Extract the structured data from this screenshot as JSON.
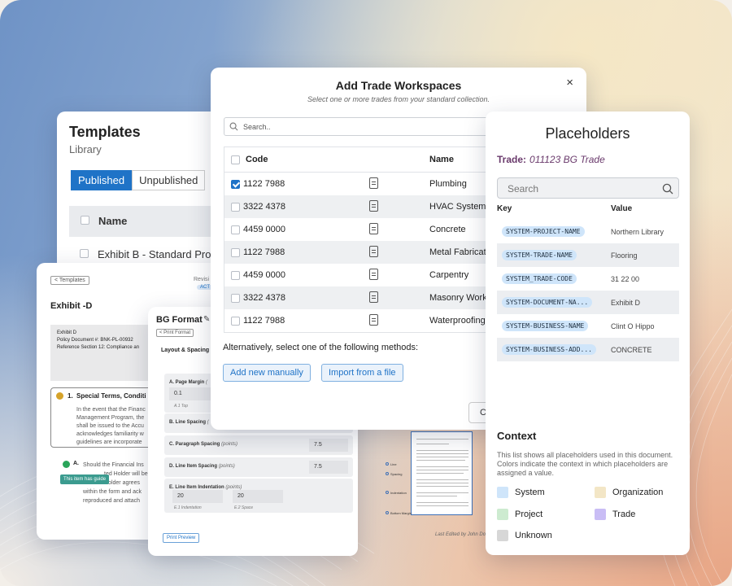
{
  "templates": {
    "title": "Templates",
    "subtitle": "Library",
    "tabs": [
      "Published",
      "Unpublished"
    ],
    "column_name": "Name",
    "rows": [
      "Exhibit B - Standard Pro"
    ]
  },
  "exhibit": {
    "back": "< Templates",
    "revision_label": "Revisi",
    "status": "ACT",
    "title": "Exhibit -D",
    "doc_lines": [
      "Exhibit D",
      "Policy Document #: BNK-PL-00932",
      "Reference Section 12: Compliance an"
    ],
    "section_num": "1.",
    "section_title": "Special Terms, Conditi",
    "section_body": [
      "In the event that the Financ",
      "Management Program, the",
      "shall be issued to the Accu",
      "acknowledges familiarity w",
      "guidelines are incorporate"
    ],
    "item_label": "A.",
    "item_body": [
      "Should the Financial Ins",
      "ted Holder will be",
      "Holder agrees",
      "within the form and ack",
      "reproduced and attach"
    ],
    "tooltip": "This item has guide"
  },
  "bgformat": {
    "title": "BG Format",
    "print_format": "< Print Format",
    "layout_heading": "Layout & Spacing",
    "page_margin_label": "A. Page Margin",
    "page_margin_unit": "(",
    "page_margin_value": "0.1",
    "page_margin_hint": "A.1 Top",
    "line_spacing_label": "B. Line Spacing",
    "line_spacing_unit": "(",
    "para_spacing_label": "C. Paragraph Spacing",
    "para_spacing_unit": "(points)",
    "para_spacing_value": "7.5",
    "line_item_spacing_label": "D. Line Item Spacing",
    "line_item_spacing_unit": "(points)",
    "line_item_spacing_value": "7.5",
    "indent_label": "E. Line Item Indentation",
    "indent_unit": "(points)",
    "indent_value_1": "20",
    "indent_value_2": "20",
    "indent_hint_1": "E.1 Indentation",
    "indent_hint_2": "E.2 Space",
    "print_preview": "Print Preview"
  },
  "preview": {
    "side_labels": [
      "Line",
      "Spacing",
      "Indentation",
      "Bottom Margin"
    ],
    "last_edited": "Last Edited by John Do"
  },
  "trade_modal": {
    "title": "Add Trade Workspaces",
    "subtitle": "Select one or more trades from your standard collection.",
    "close": "×",
    "search_placeholder": "Search..",
    "col_code": "Code",
    "col_name": "Name",
    "rows": [
      {
        "code": "1122 7988",
        "name": "Plumbing",
        "checked": true
      },
      {
        "code": "3322 4378",
        "name": "HVAC Systems",
        "checked": false
      },
      {
        "code": "4459 0000",
        "name": "Concrete",
        "checked": false
      },
      {
        "code": "1122 7988",
        "name": "Metal Fabricat",
        "checked": false
      },
      {
        "code": "4459 0000",
        "name": "Carpentry",
        "checked": false
      },
      {
        "code": "3322 4378",
        "name": "Masonry Work",
        "checked": false
      },
      {
        "code": "1122 7988",
        "name": "Waterproofing",
        "checked": false
      }
    ],
    "alternative_text": "Alternatively, select one of the following methods:",
    "add_manually": "Add new manually",
    "import_file": "Import from a file",
    "cancel": "C"
  },
  "placeholders": {
    "title": "Placeholders",
    "trade_label": "Trade:",
    "trade_value": "011123 BG Trade",
    "search_placeholder": "Search",
    "col_key": "Key",
    "col_value": "Value",
    "rows": [
      {
        "key": "SYSTEM-PROJECT-NAME",
        "value": "Northern Library"
      },
      {
        "key": "SYSTEM-TRADE-NAME",
        "value": "Flooring"
      },
      {
        "key": "SYSTEM_TRADE-CODE",
        "value": "31 22 00"
      },
      {
        "key": "SYSTEM-DOCUMENT-NA...",
        "value": "Exhibit D"
      },
      {
        "key": "SYSTEM-BUSINESS-NAME",
        "value": "Clint O Hippo"
      },
      {
        "key": "SYSTEM-BUSINESS-ADD...",
        "value": "CONCRETE"
      }
    ],
    "context_title": "Context",
    "context_desc": "This list shows all placeholders used in this document. Colors indicate the context in which placeholders are assigned a value.",
    "legend": [
      {
        "label": "System",
        "color": "#cfe5fa"
      },
      {
        "label": "Organization",
        "color": "#f3e6c6"
      },
      {
        "label": "Project",
        "color": "#cdebd0"
      },
      {
        "label": "Trade",
        "color": "#c9bdf5"
      },
      {
        "label": "Unknown",
        "color": "#d7d7d7"
      }
    ]
  },
  "colors": {
    "accent": "#1f73c7",
    "trade_label": "#6a3a6c"
  },
  "icons": [
    "search-icon",
    "close-icon",
    "document-icon",
    "pencil-icon",
    "check-icon"
  ]
}
